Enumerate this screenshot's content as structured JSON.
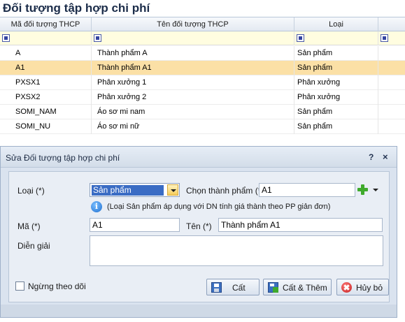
{
  "list": {
    "title": "Đối tượng tập hợp chi phí",
    "columns": [
      "Mã đối tượng THCP",
      "Tên đối tượng THCP",
      "Loại"
    ],
    "rows": [
      {
        "code": "A",
        "name": "Thành phẩm A",
        "type": "Sản phẩm"
      },
      {
        "code": "A1",
        "name": "Thành phẩm A1",
        "type": "Sản phẩm"
      },
      {
        "code": "PXSX1",
        "name": "Phân xưởng 1",
        "type": "Phân xưởng"
      },
      {
        "code": "PXSX2",
        "name": "Phân xưởng 2",
        "type": "Phân xưởng"
      },
      {
        "code": "SOMI_NAM",
        "name": "Áo sơ mi nam",
        "type": "Sản phẩm"
      },
      {
        "code": "SOMI_NU",
        "name": "Áo sơ mi nữ",
        "type": "Sản phẩm"
      }
    ],
    "selected_row_index": 1
  },
  "dialog": {
    "title": "Sửa Đối tượng tập hợp chi phí",
    "help_label": "?",
    "close_label": "×",
    "type_label": "Loại (*)",
    "type_value": "Sản phẩm",
    "product_label": "Chọn thành phẩm (*)",
    "product_value": "A1",
    "info_note": "(Loại Sản phẩm áp dụng với DN tính giá thành theo PP giản đơn)",
    "info_icon_glyph": "i",
    "code_label": "Mã (*)",
    "code_value": "A1",
    "name_label": "Tên (*)",
    "name_value": "Thành phẩm A1",
    "desc_label": "Diễn giải",
    "desc_value": "",
    "stop_tracking_label": "Ngừng theo dõi",
    "stop_tracking_checked": false,
    "buttons": {
      "save": "Cất",
      "save_add": "Cất & Thêm",
      "cancel": "Hủy bỏ"
    }
  },
  "colors": {
    "selected_row": "#fbe0a6",
    "filter_row": "#fffde0",
    "dialog_bg": "#dae3ef",
    "combo_highlight": "#3a6cc4"
  }
}
